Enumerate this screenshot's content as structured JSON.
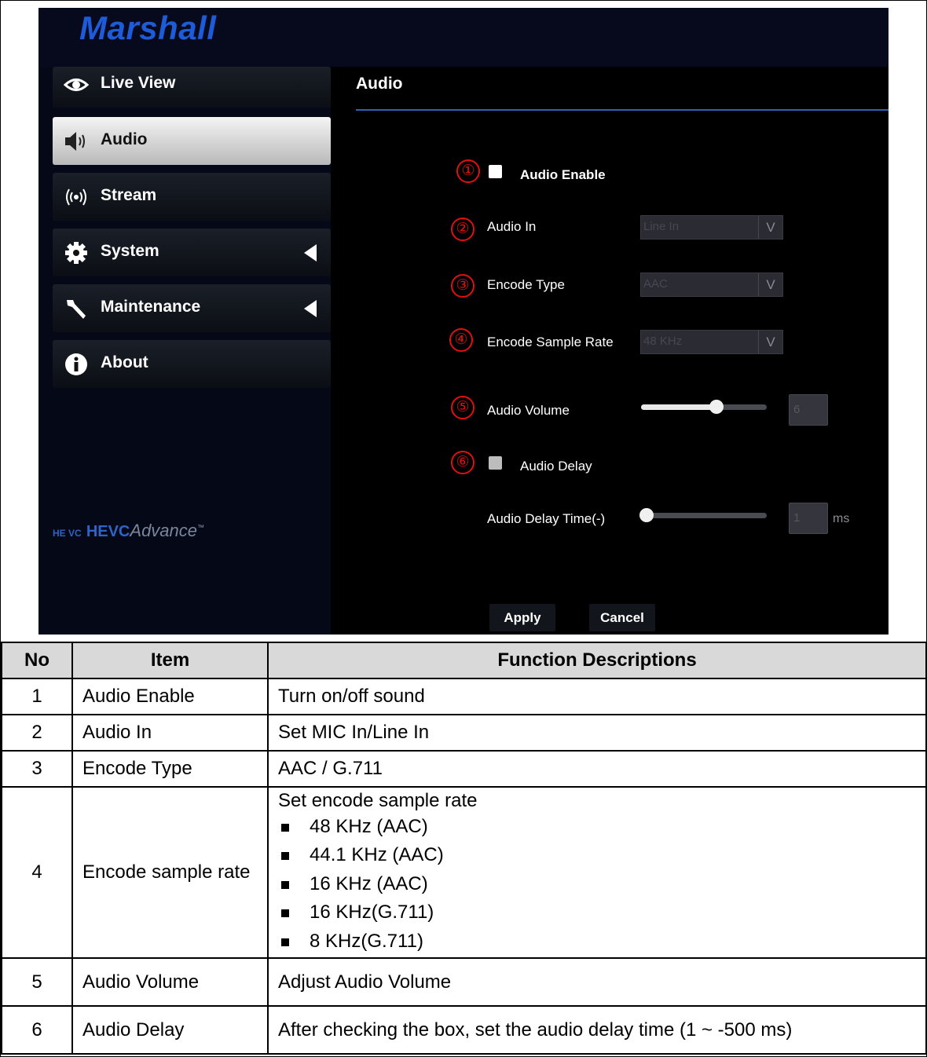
{
  "brand": "Marshall",
  "sidebar": {
    "items": [
      {
        "label": "Live View",
        "icon": "eye-icon"
      },
      {
        "label": "Audio",
        "icon": "speaker-icon"
      },
      {
        "label": "Stream",
        "icon": "broadcast-icon"
      },
      {
        "label": "System",
        "icon": "gear-icon"
      },
      {
        "label": "Maintenance",
        "icon": "wrench-icon"
      },
      {
        "label": "About",
        "icon": "info-icon"
      }
    ],
    "active": "Audio",
    "hevc_logo": {
      "mark": "HE VC",
      "text_bold": "HEVC",
      "text_light": "Advance",
      "tm": "™"
    }
  },
  "page": {
    "title": "Audio",
    "markers": [
      "①",
      "②",
      "③",
      "④",
      "⑤",
      "⑥"
    ],
    "audio_enable": {
      "label": "Audio Enable",
      "checked": false
    },
    "audio_in": {
      "label": "Audio In",
      "value": "Line In"
    },
    "encode_type": {
      "label": "Encode Type",
      "value": "AAC"
    },
    "encode_sample_rate": {
      "label": "Encode Sample Rate",
      "value": "48 KHz"
    },
    "audio_volume": {
      "label": "Audio Volume",
      "value": "6",
      "level": 0.6
    },
    "audio_delay": {
      "label": "Audio Delay",
      "checked": false
    },
    "audio_delay_time": {
      "label": "Audio Delay Time(-)",
      "value": "1",
      "unit": "ms",
      "level": 0.0
    },
    "apply_label": "Apply",
    "cancel_label": "Cancel",
    "select_arrow": "V"
  },
  "table": {
    "headers": [
      "No",
      "Item",
      "Function Descriptions"
    ],
    "rows": [
      {
        "no": "1",
        "item": "Audio Enable",
        "desc": "Turn on/off sound"
      },
      {
        "no": "2",
        "item": "Audio In",
        "desc": "Set MIC In/Line In"
      },
      {
        "no": "3",
        "item": "Encode Type",
        "desc": "AAC / G.711"
      },
      {
        "no": "4",
        "item": "Encode sample rate",
        "desc": "Set encode sample rate",
        "bullets": [
          "48 KHz (AAC)",
          "44.1 KHz (AAC)",
          "16 KHz (AAC)",
          "16 KHz(G.711)",
          "8 KHz(G.711)"
        ]
      },
      {
        "no": "5",
        "item": "Audio Volume",
        "desc": "Adjust Audio Volume"
      },
      {
        "no": "6",
        "item": "Audio Delay",
        "desc": "After checking the box, set the audio delay time (1 ~ -500 ms)"
      }
    ]
  },
  "colors": {
    "brand": "#1e5bd8",
    "accent_line": "#2c62b8",
    "marker": "#e01010"
  }
}
